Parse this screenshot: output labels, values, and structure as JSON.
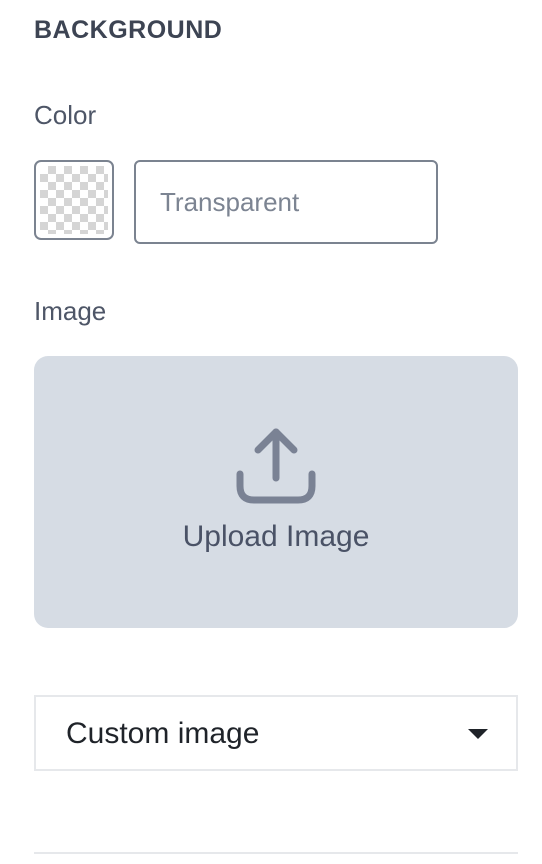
{
  "section": {
    "title": "BACKGROUND"
  },
  "color": {
    "label": "Color",
    "swatch_icon": "transparent-checker-icon",
    "placeholder": "Transparent",
    "value": ""
  },
  "image": {
    "label": "Image",
    "upload_icon": "upload-icon",
    "upload_label": "Upload Image",
    "upload_bg_color": "#d6dce4"
  },
  "image_source": {
    "selected": "Custom image",
    "caret_icon": "caret-down-icon"
  }
}
